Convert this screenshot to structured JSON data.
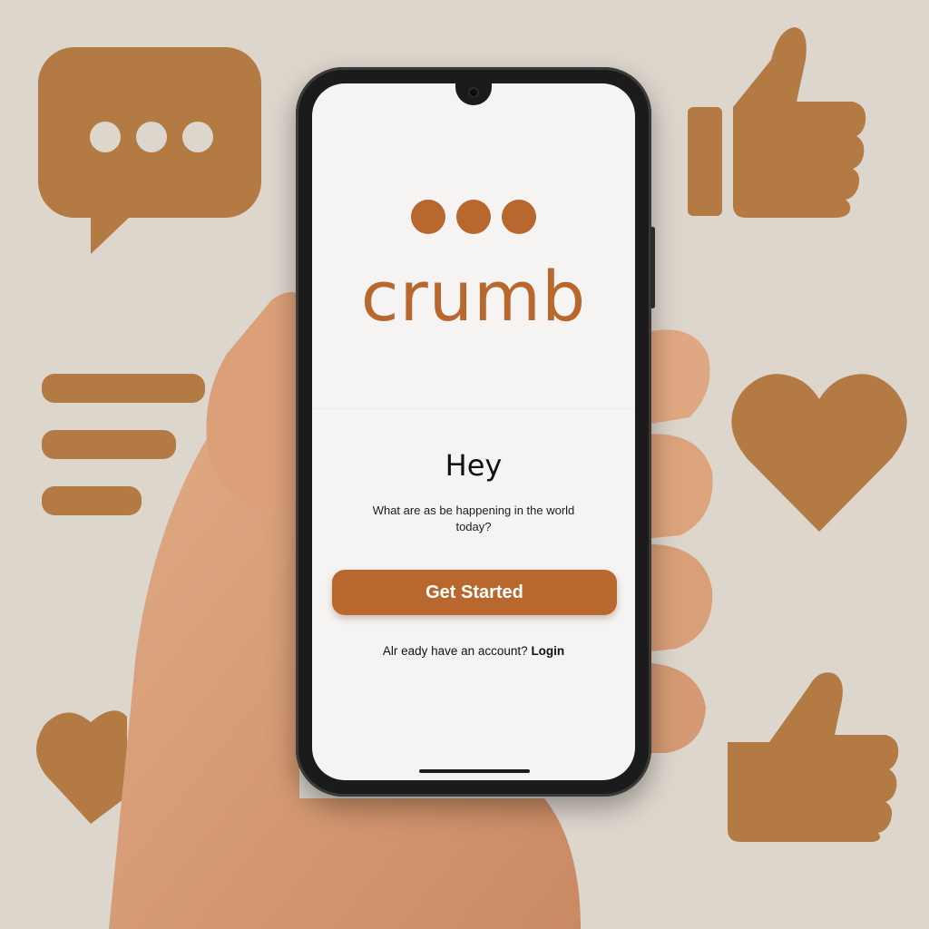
{
  "app": {
    "brand": "crumb",
    "headline": "Hey",
    "subtext": "What are as be happening in the world today?",
    "cta_label": "Get Started",
    "login_prompt": "Alr eady have an account?",
    "login_link": "Login"
  },
  "background_icons": [
    "speech-bubble-icon",
    "thumbs-up-icon",
    "text-lines-icon",
    "heart-icon",
    "heart-icon",
    "thumbs-up-icon"
  ],
  "colors": {
    "accent": "#b8682f",
    "background": "#ddd6cd",
    "screen": "#f5f4f3",
    "icon": "#b47a44"
  }
}
